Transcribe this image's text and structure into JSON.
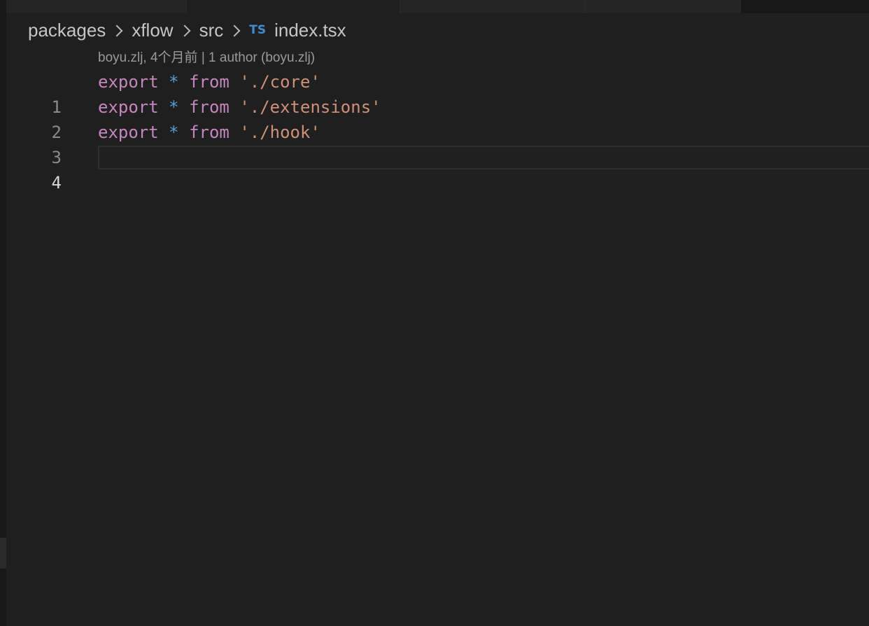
{
  "breadcrumb": {
    "items": [
      "packages",
      "xflow",
      "src"
    ],
    "file_icon": "TS",
    "file_name": "index.tsx"
  },
  "codelens": {
    "text": "boyu.zlj, 4个月前 | 1 author (boyu.zlj)"
  },
  "editor": {
    "language": "typescript",
    "current_line": 4,
    "lines": [
      {
        "number": "1",
        "keyword": "export",
        "operator": "*",
        "from": "from",
        "string": "'./core'"
      },
      {
        "number": "2",
        "keyword": "export",
        "operator": "*",
        "from": "from",
        "string": "'./extensions'"
      },
      {
        "number": "3",
        "keyword": "export",
        "operator": "*",
        "from": "from",
        "string": "'./hook'"
      },
      {
        "number": "4"
      }
    ]
  },
  "colors": {
    "background": "#1f1f1f",
    "keyword": "#c586c0",
    "operator": "#569cd6",
    "string": "#ce9178",
    "ts_icon": "#3d8fd1"
  }
}
